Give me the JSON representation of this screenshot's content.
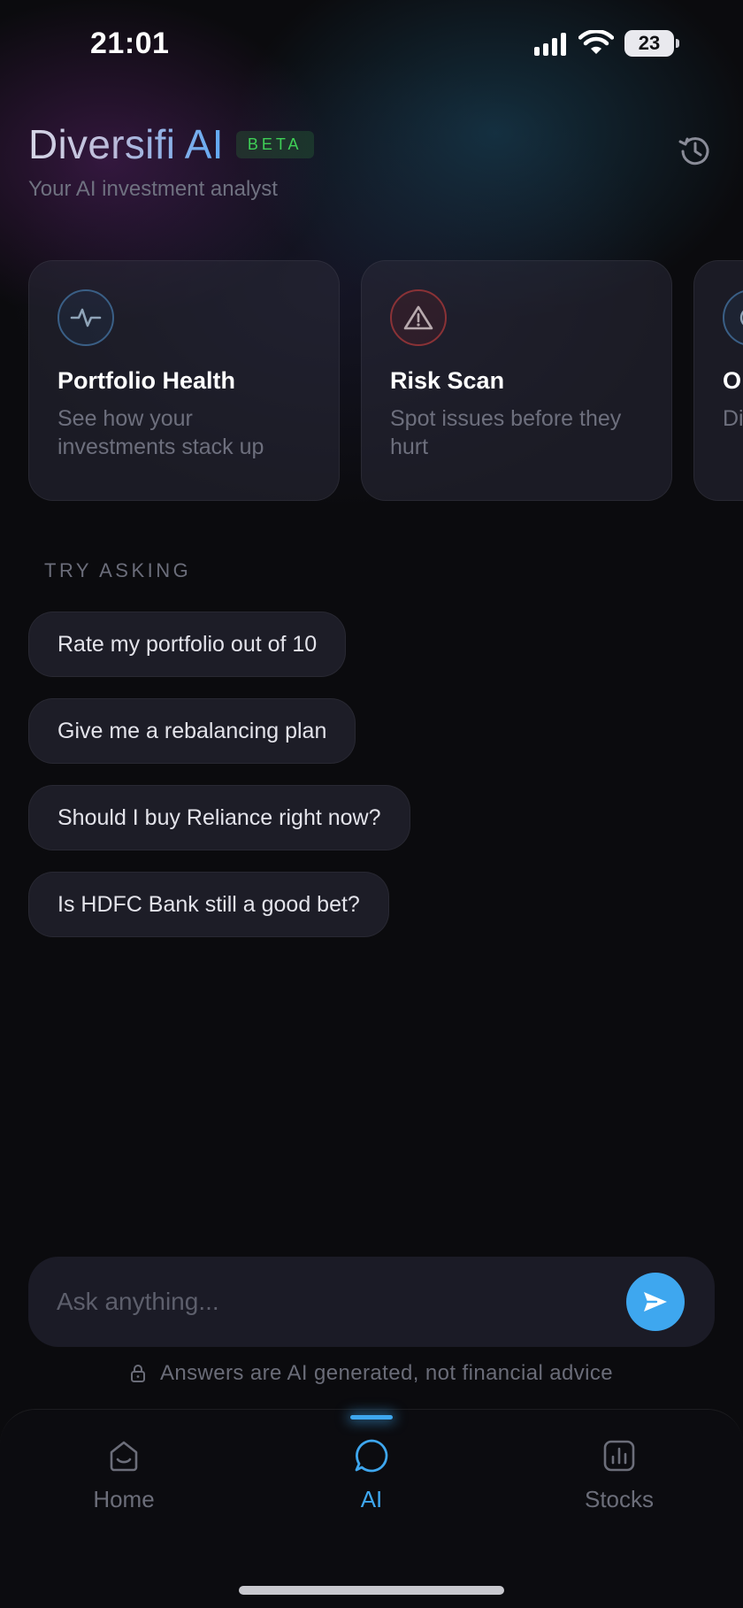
{
  "status_bar": {
    "time": "21:01",
    "battery_level": "23"
  },
  "header": {
    "title": "Diversifi AI",
    "badge": "BETA",
    "subtitle": "Your AI investment analyst",
    "history_icon": "history-icon"
  },
  "cards": [
    {
      "icon": "pulse-icon",
      "icon_color": "#4f8fc9",
      "title": "Portfolio Health",
      "description": "See how your investments stack up"
    },
    {
      "icon": "warning-icon",
      "icon_color": "#d24a4a",
      "title": "Risk Scan",
      "description": "Spot issues before they hurt"
    },
    {
      "icon": "clock-icon",
      "icon_color": "#4f8fc9",
      "title": "O",
      "description": "Di tr"
    }
  ],
  "suggestions": {
    "label": "TRY ASKING",
    "items": [
      "Rate my portfolio out of 10",
      "Give me a rebalancing plan",
      "Should I buy Reliance right now?",
      "Is HDFC Bank still a good bet?"
    ]
  },
  "input": {
    "placeholder": "Ask anything...",
    "value": ""
  },
  "disclaimer": "Answers are AI generated, not financial advice",
  "tabs": [
    {
      "label": "Home",
      "icon": "home-icon",
      "active": false
    },
    {
      "label": "AI",
      "icon": "chat-bubble-icon",
      "active": true
    },
    {
      "label": "Stocks",
      "icon": "chart-icon",
      "active": false
    }
  ],
  "colors": {
    "accent": "#3ea7ef",
    "badge_green": "#3fcf56",
    "background": "#0b0b0e"
  }
}
